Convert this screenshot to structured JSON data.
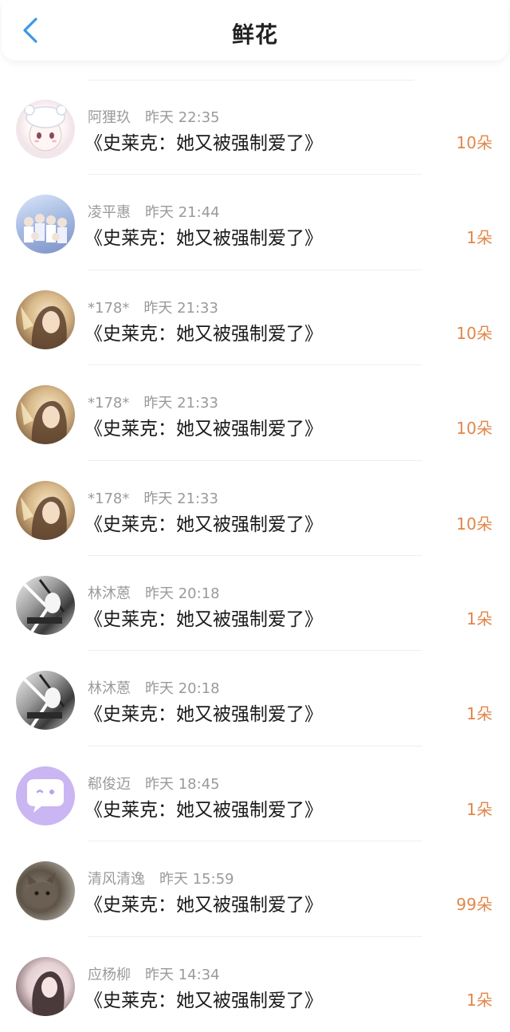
{
  "header": {
    "title": "鲜花",
    "back_icon": "chevron-left-icon",
    "accent_color": "#3d97e8"
  },
  "colors": {
    "flower_count": "#e0874a",
    "meta_text": "#9a9a9a"
  },
  "items": [
    {
      "name": "阿狸玖",
      "time": "昨天 22:35",
      "book": "《史莱克：她又被强制爱了》",
      "flowers": "10朵",
      "avatar": "avatar-anime-girl-bear-hat"
    },
    {
      "name": "凌平惠",
      "time": "昨天 21:44",
      "book": "《史莱克：她又被强制爱了》",
      "flowers": "1朵",
      "avatar": "avatar-group-photo"
    },
    {
      "name": "*178*",
      "time": "昨天 21:33",
      "book": "《史莱克：她又被强制爱了》",
      "flowers": "10朵",
      "avatar": "avatar-illustrated-girl"
    },
    {
      "name": "*178*",
      "time": "昨天 21:33",
      "book": "《史莱克：她又被强制爱了》",
      "flowers": "10朵",
      "avatar": "avatar-illustrated-girl"
    },
    {
      "name": "*178*",
      "time": "昨天 21:33",
      "book": "《史莱克：她又被强制爱了》",
      "flowers": "10朵",
      "avatar": "avatar-illustrated-girl"
    },
    {
      "name": "林沐蒽",
      "time": "昨天 20:18",
      "book": "《史莱克：她又被强制爱了》",
      "flowers": "1朵",
      "avatar": "avatar-manga-bw"
    },
    {
      "name": "林沐蒽",
      "time": "昨天 20:18",
      "book": "《史莱克：她又被强制爱了》",
      "flowers": "1朵",
      "avatar": "avatar-manga-bw"
    },
    {
      "name": "郗俊迈",
      "time": "昨天 18:45",
      "book": "《史莱克：她又被强制爱了》",
      "flowers": "1朵",
      "avatar": "avatar-default-chat-bubble"
    },
    {
      "name": "清风清逸",
      "time": "昨天 15:59",
      "book": "《史莱克：她又被强制爱了》",
      "flowers": "99朵",
      "avatar": "avatar-cat-photo"
    },
    {
      "name": "应杨柳",
      "time": "昨天 14:34",
      "book": "《史莱克：她又被强制爱了》",
      "flowers": "1朵",
      "avatar": "avatar-woman-photo"
    }
  ]
}
